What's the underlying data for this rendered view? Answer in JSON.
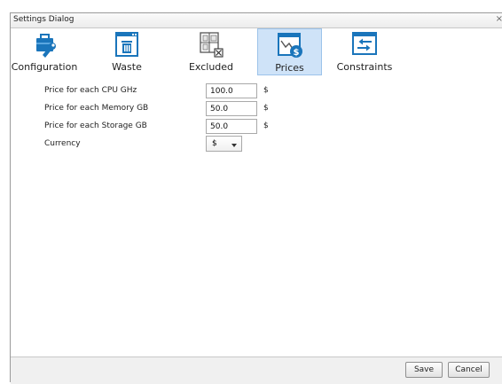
{
  "window": {
    "title": "Settings Dialog",
    "close_glyph": "×"
  },
  "toolbar": {
    "items": [
      {
        "label": "Configuration",
        "icon": "toolbox-wrench-icon",
        "selected": false
      },
      {
        "label": "Waste",
        "icon": "trash-window-icon",
        "selected": false
      },
      {
        "label": "Excluded",
        "icon": "excluded-grid-icon",
        "selected": false
      },
      {
        "label": "Prices",
        "icon": "price-chart-dollar-icon",
        "selected": true
      },
      {
        "label": "Constraints",
        "icon": "constraints-arrows-icon",
        "selected": false
      }
    ]
  },
  "form": {
    "cpu": {
      "label": "Price for each CPU GHz",
      "value": "100.0",
      "unit": "$"
    },
    "memory": {
      "label": "Price for each Memory GB",
      "value": "50.0",
      "unit": "$"
    },
    "storage": {
      "label": "Price for each Storage GB",
      "value": "50.0",
      "unit": "$"
    },
    "currency": {
      "label": "Currency",
      "value": "$"
    }
  },
  "footer": {
    "save_label": "Save",
    "cancel_label": "Cancel"
  },
  "colors": {
    "accent": "#1a75bb",
    "selected_bg": "#cfe3f8",
    "selected_border": "#9cc3ea"
  }
}
